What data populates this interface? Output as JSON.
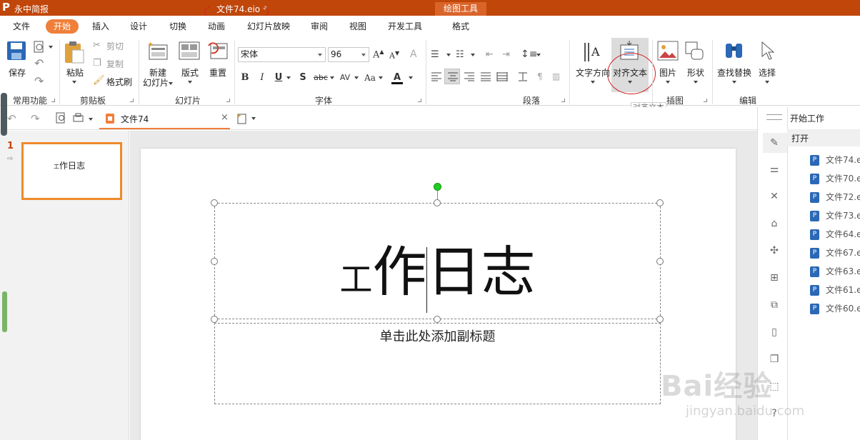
{
  "app": {
    "name": "永中简报",
    "doc_title": "文件74.eio *",
    "context_tab": "绘图工具"
  },
  "menu": [
    "文件",
    "开始",
    "插入",
    "设计",
    "切换",
    "动画",
    "幻灯片放映",
    "审阅",
    "视图",
    "开发工具",
    "格式"
  ],
  "active_menu": "开始",
  "ribbon": {
    "save": "保存",
    "paste": "粘贴",
    "cut": "剪切",
    "copy": "复制",
    "format_painter": "格式刷",
    "new_slide_1": "新建",
    "new_slide_2": "幻灯片",
    "layout": "版式",
    "reset": "重置",
    "font_name": "宋体",
    "font_size": "96",
    "text_direction": "文字方向",
    "align_text": "对齐文本",
    "picture": "图片",
    "shape": "形状",
    "find_replace": "查找替换",
    "select": "选择",
    "groups": {
      "common": "常用功能",
      "clipboard": "剪贴板",
      "slides": "幻灯片",
      "font": "字体",
      "paragraph": "段落",
      "illustration": "插图",
      "edit": "编辑"
    },
    "tooltip": "对齐文本"
  },
  "doc_tab": {
    "label": "文件74"
  },
  "slides_panel": {
    "number": "1",
    "thumb_small": "工",
    "thumb_rest": "作日志"
  },
  "slide": {
    "title_small": "工",
    "title_rest": "作日志",
    "subtitle_placeholder": "单击此处添加副标题"
  },
  "right_panel": {
    "header": "开始工作",
    "open": "打开",
    "files": [
      "文件74.e",
      "文件70.e",
      "文件72.e",
      "文件73.e",
      "文件64.e",
      "文件67.e",
      "文件63.e",
      "文件61.e",
      "文件60.e"
    ]
  },
  "watermark": {
    "main": "Bai经验",
    "sub": "jingyan.baidu.com"
  },
  "colors": {
    "brand": "#c0460a",
    "active_tab": "#ef7f3a",
    "slide_border": "#ef8a2b",
    "annotation": "#d02020"
  }
}
